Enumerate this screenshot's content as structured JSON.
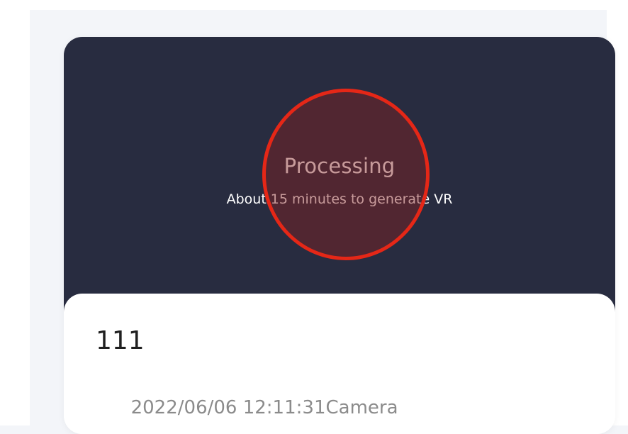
{
  "card": {
    "status_title": "Processing",
    "status_subtitle": "About 15 minutes to generate VR",
    "item_name": "111",
    "item_datetime": "2022/06/06 12:11:31",
    "item_source": "Camera"
  },
  "colors": {
    "preview_bg": "#282c40",
    "highlight_ring": "#e52717",
    "title_text": "#1f1f1f",
    "meta_text": "#8b8b8b"
  }
}
